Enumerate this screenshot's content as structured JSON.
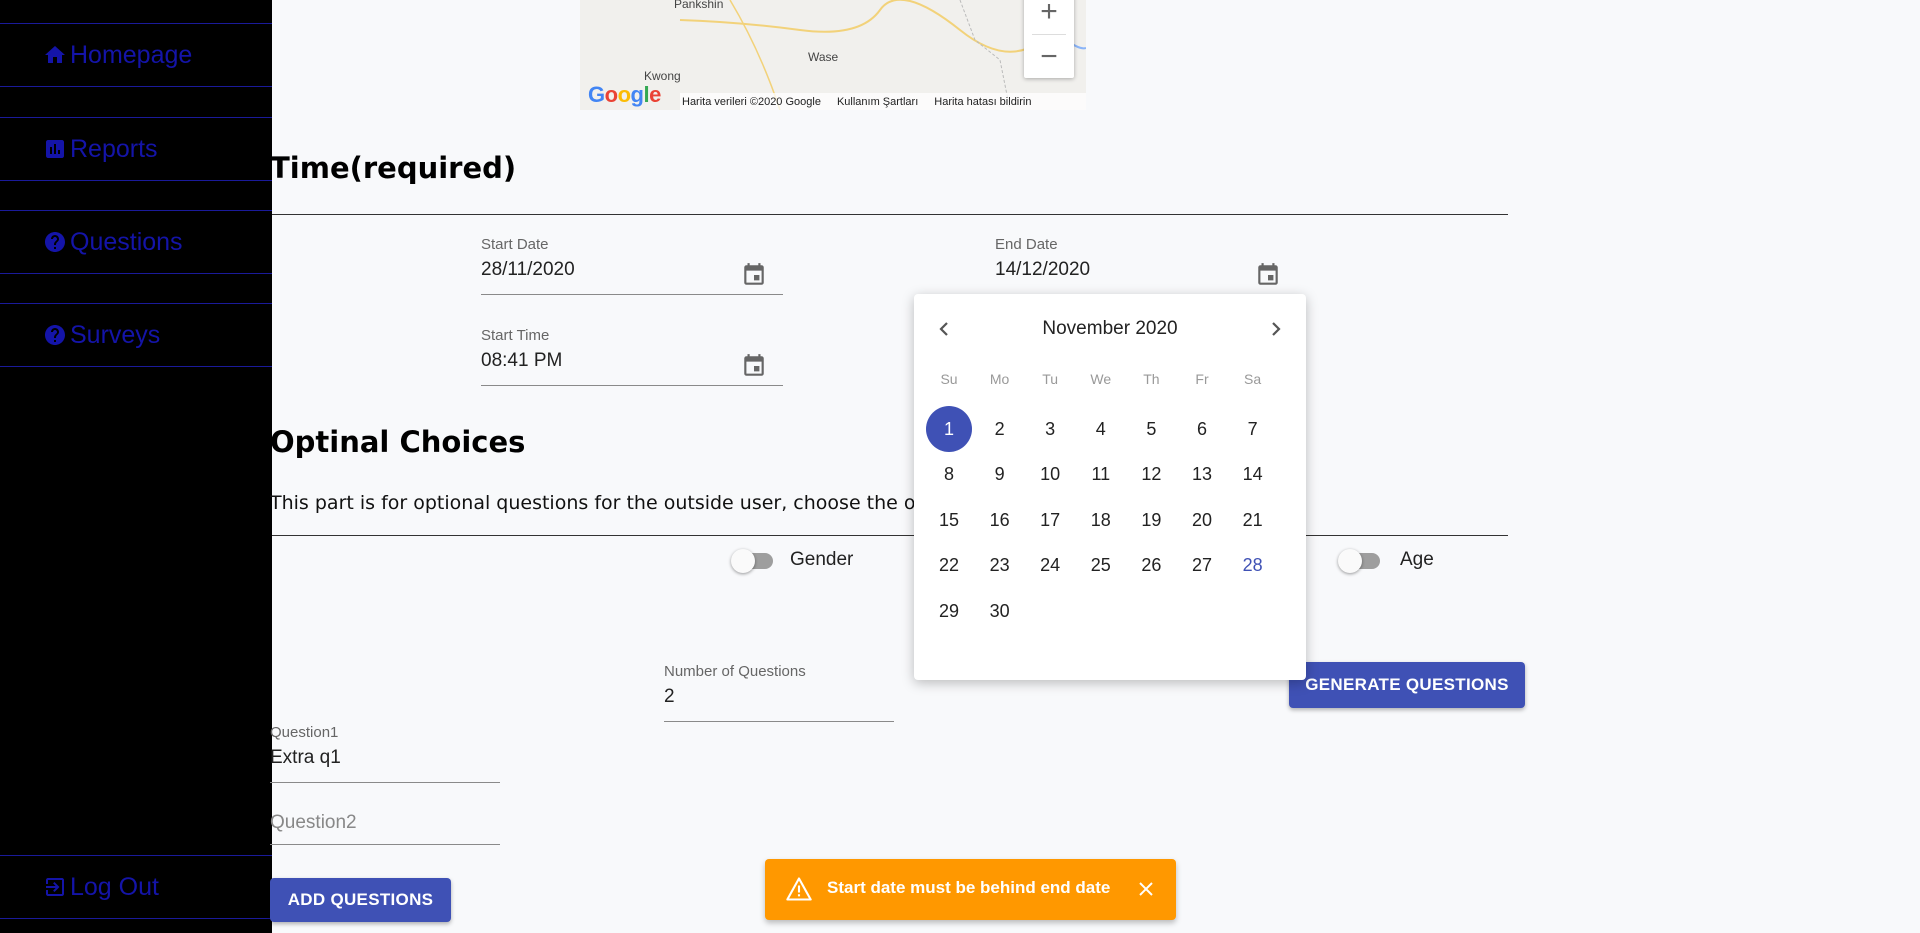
{
  "sidebar": {
    "items": [
      {
        "label": "Homepage",
        "icon": "home-icon"
      },
      {
        "label": "Reports",
        "icon": "chart-icon"
      },
      {
        "label": "Questions",
        "icon": "help-icon"
      },
      {
        "label": "Surveys",
        "icon": "help-icon"
      }
    ],
    "logout_label": "Log Out"
  },
  "map": {
    "places": [
      "Pankshin",
      "Wase",
      "Kwong"
    ],
    "logo": "Google",
    "attribution": [
      "Harita verileri ©2020 Google",
      "Kullanım Şartları",
      "Harita hatası bildirin"
    ]
  },
  "time_section": {
    "title": "Time(required)",
    "start_date": {
      "label": "Start Date",
      "value": "28/11/2020"
    },
    "end_date": {
      "label": "End Date",
      "value": "14/12/2020"
    },
    "start_time": {
      "label": "Start Time",
      "value": "08:41 PM"
    }
  },
  "optional_section": {
    "title": "Optinal Choices",
    "description": "This part is for optional questions for the outside user, choose the ones y",
    "toggles": [
      {
        "label": "Gender",
        "on": false
      },
      {
        "label": "Age",
        "on": false
      }
    ]
  },
  "questions": {
    "number_label": "Number of Questions",
    "number_value": "2",
    "generate_label": "GENERATE QUESTIONS",
    "question1_label": "Question1",
    "question1_value": "Extra q1",
    "question2_placeholder": "Question2",
    "add_label": "ADD QUESTIONS"
  },
  "calendar": {
    "month_title": "November 2020",
    "weekdays": [
      "Su",
      "Mo",
      "Tu",
      "We",
      "Th",
      "Fr",
      "Sa"
    ],
    "days": [
      "1",
      "2",
      "3",
      "4",
      "5",
      "6",
      "7",
      "8",
      "9",
      "10",
      "11",
      "12",
      "13",
      "14",
      "15",
      "16",
      "17",
      "18",
      "19",
      "20",
      "21",
      "22",
      "23",
      "24",
      "25",
      "26",
      "27",
      "28",
      "29",
      "30"
    ],
    "selected_day": "1",
    "highlighted_day": "28",
    "accent_color": "#3f51b5"
  },
  "toast": {
    "message": "Start date must be behind end date",
    "color": "#ff9800"
  }
}
